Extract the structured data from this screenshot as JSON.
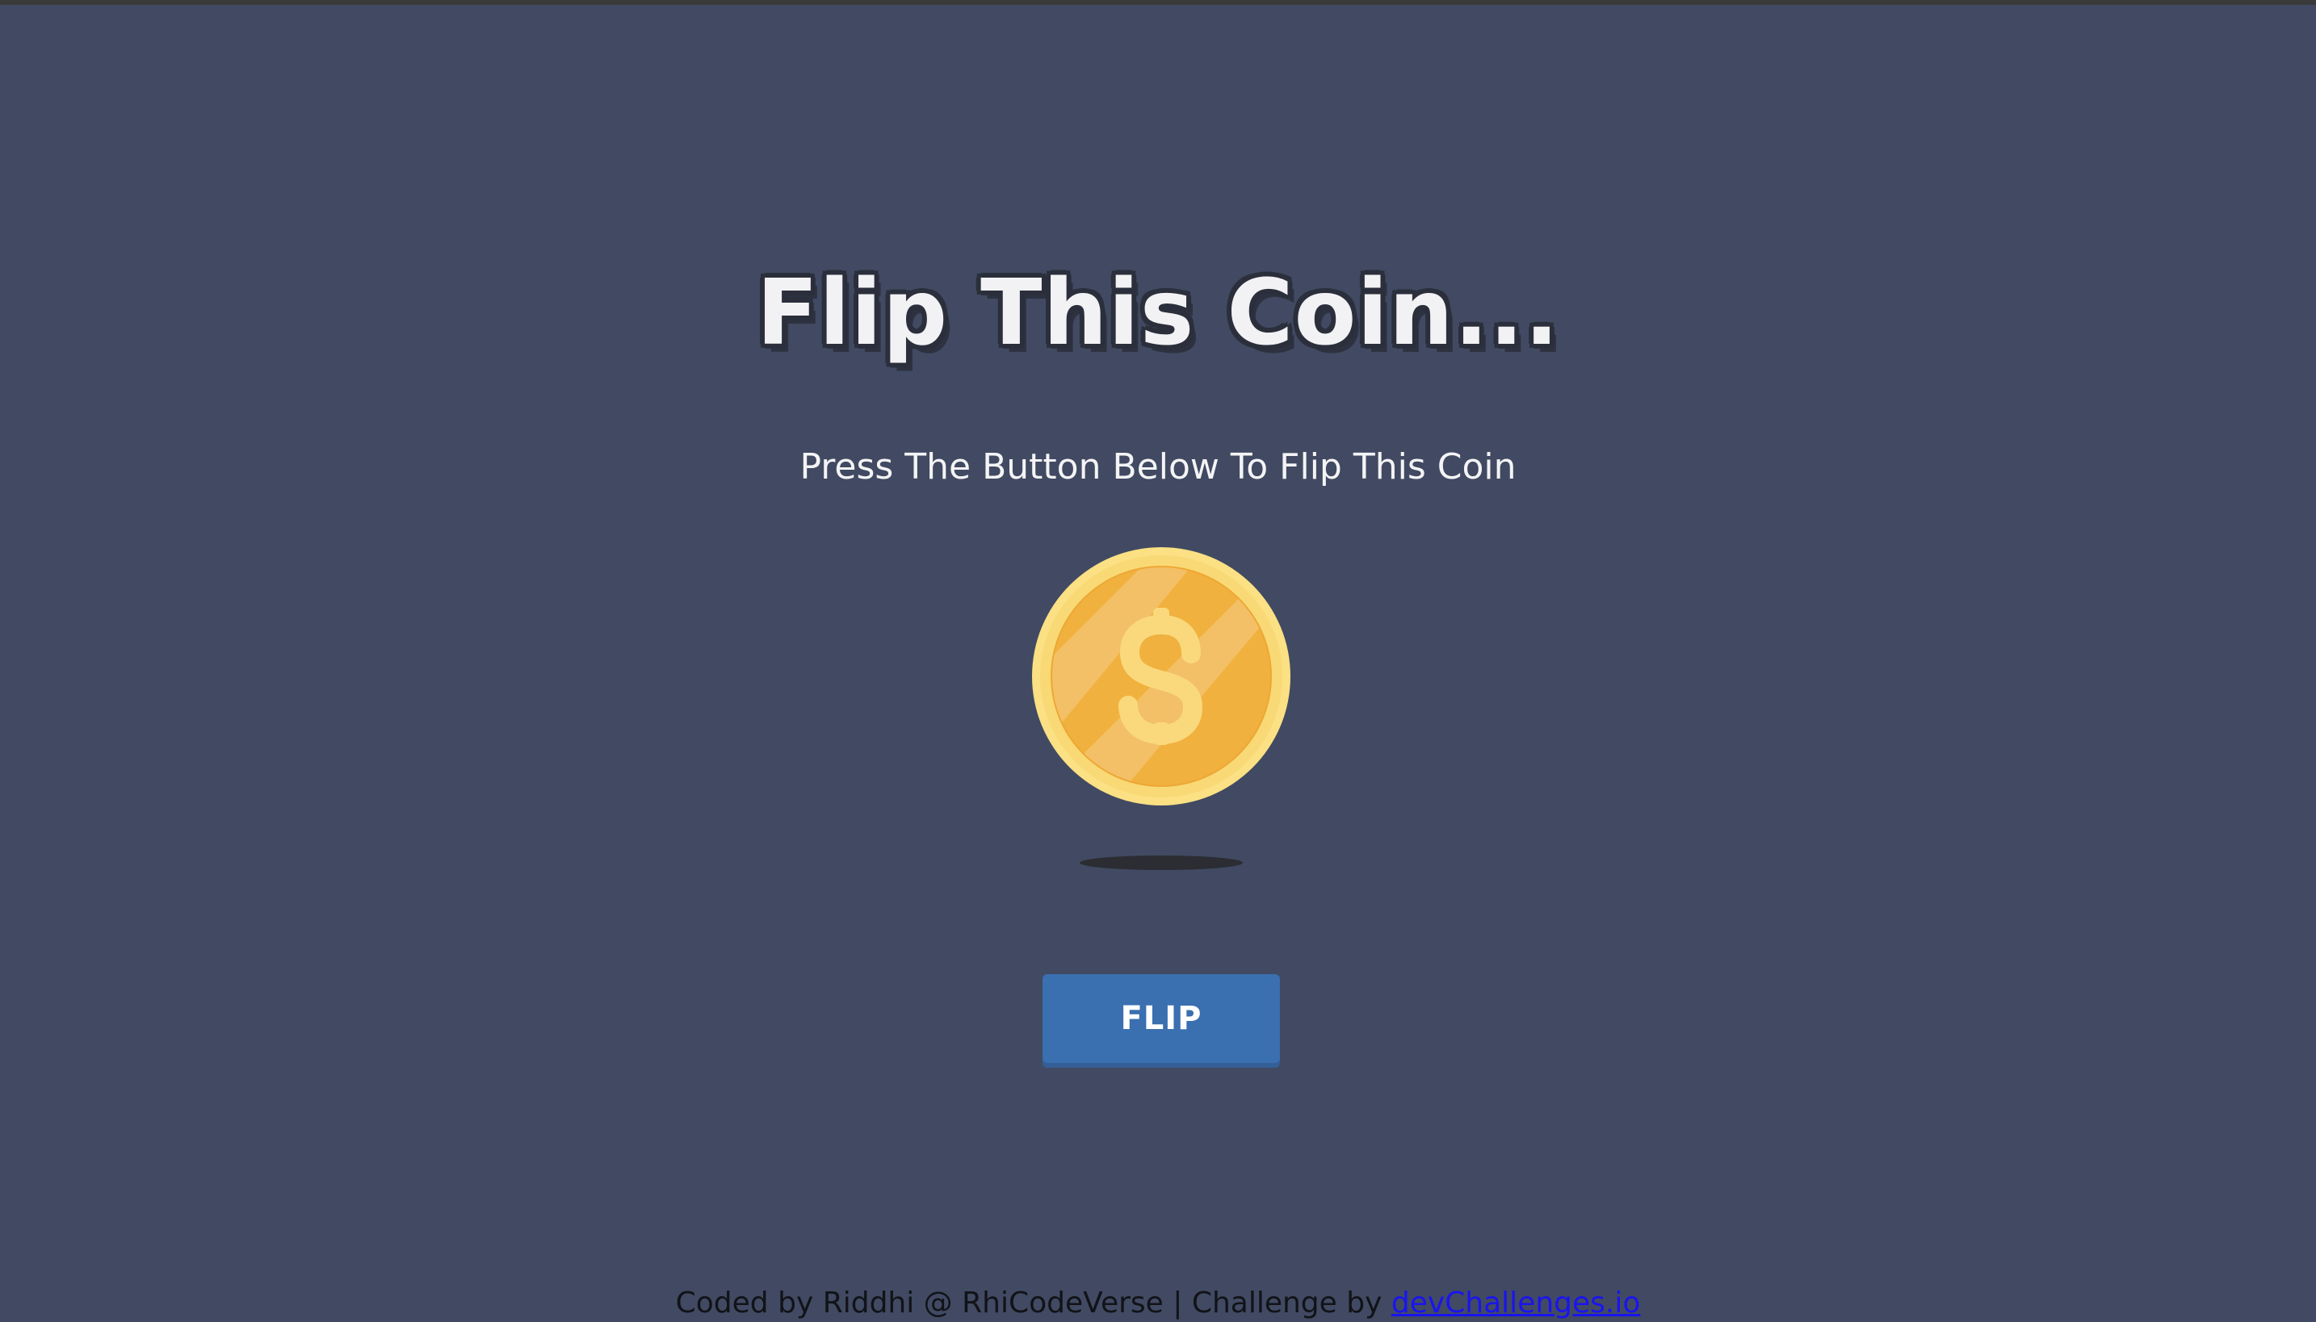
{
  "page": {
    "title": "Flip This Coin...",
    "subtitle": "Press The Button Below To Flip This Coin"
  },
  "coin": {
    "symbol": "$",
    "face_color": "#f0b13f",
    "rim_color": "#fbe084"
  },
  "flip_button": {
    "label": "FLIP",
    "color": "#3a6fb0"
  },
  "footer": {
    "text": "Coded by Riddhi @ RhiCodeVerse | Challenge by ",
    "link_text": "devChallenges.io",
    "link_color": "#1a14f0"
  },
  "colors": {
    "background": "#414a62"
  }
}
